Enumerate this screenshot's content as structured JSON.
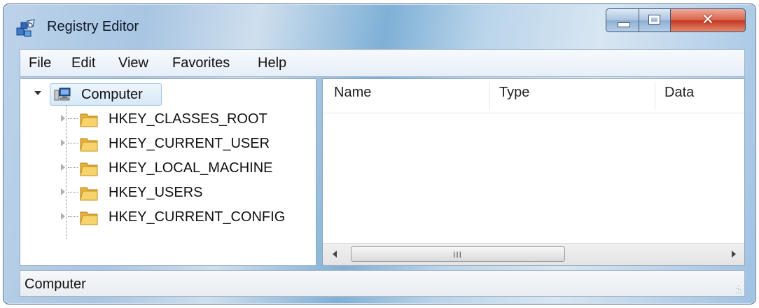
{
  "window": {
    "title": "Registry Editor",
    "icon": "registry-editor-icon",
    "controls": {
      "minimize": "minimize-icon",
      "maximize": "maximize-icon",
      "close": "✕"
    }
  },
  "menu": {
    "items": [
      "File",
      "Edit",
      "View",
      "Favorites",
      "Help"
    ]
  },
  "tree": {
    "root": {
      "label": "Computer",
      "icon": "computer-icon",
      "expanded": true
    },
    "hives": [
      {
        "label": "HKEY_CLASSES_ROOT",
        "icon": "folder-icon"
      },
      {
        "label": "HKEY_CURRENT_USER",
        "icon": "folder-icon"
      },
      {
        "label": "HKEY_LOCAL_MACHINE",
        "icon": "folder-icon"
      },
      {
        "label": "HKEY_USERS",
        "icon": "folder-icon"
      },
      {
        "label": "HKEY_CURRENT_CONFIG",
        "icon": "folder-icon"
      }
    ]
  },
  "list": {
    "columns": [
      "Name",
      "Type",
      "Data"
    ],
    "rows": [],
    "scrollbar": {
      "grip": "III"
    }
  },
  "status": {
    "text": "Computer"
  },
  "colors": {
    "close_red": "#c4361f",
    "folder_yellow": "#f2c14e",
    "selection_blue": "#d7e8f8"
  }
}
